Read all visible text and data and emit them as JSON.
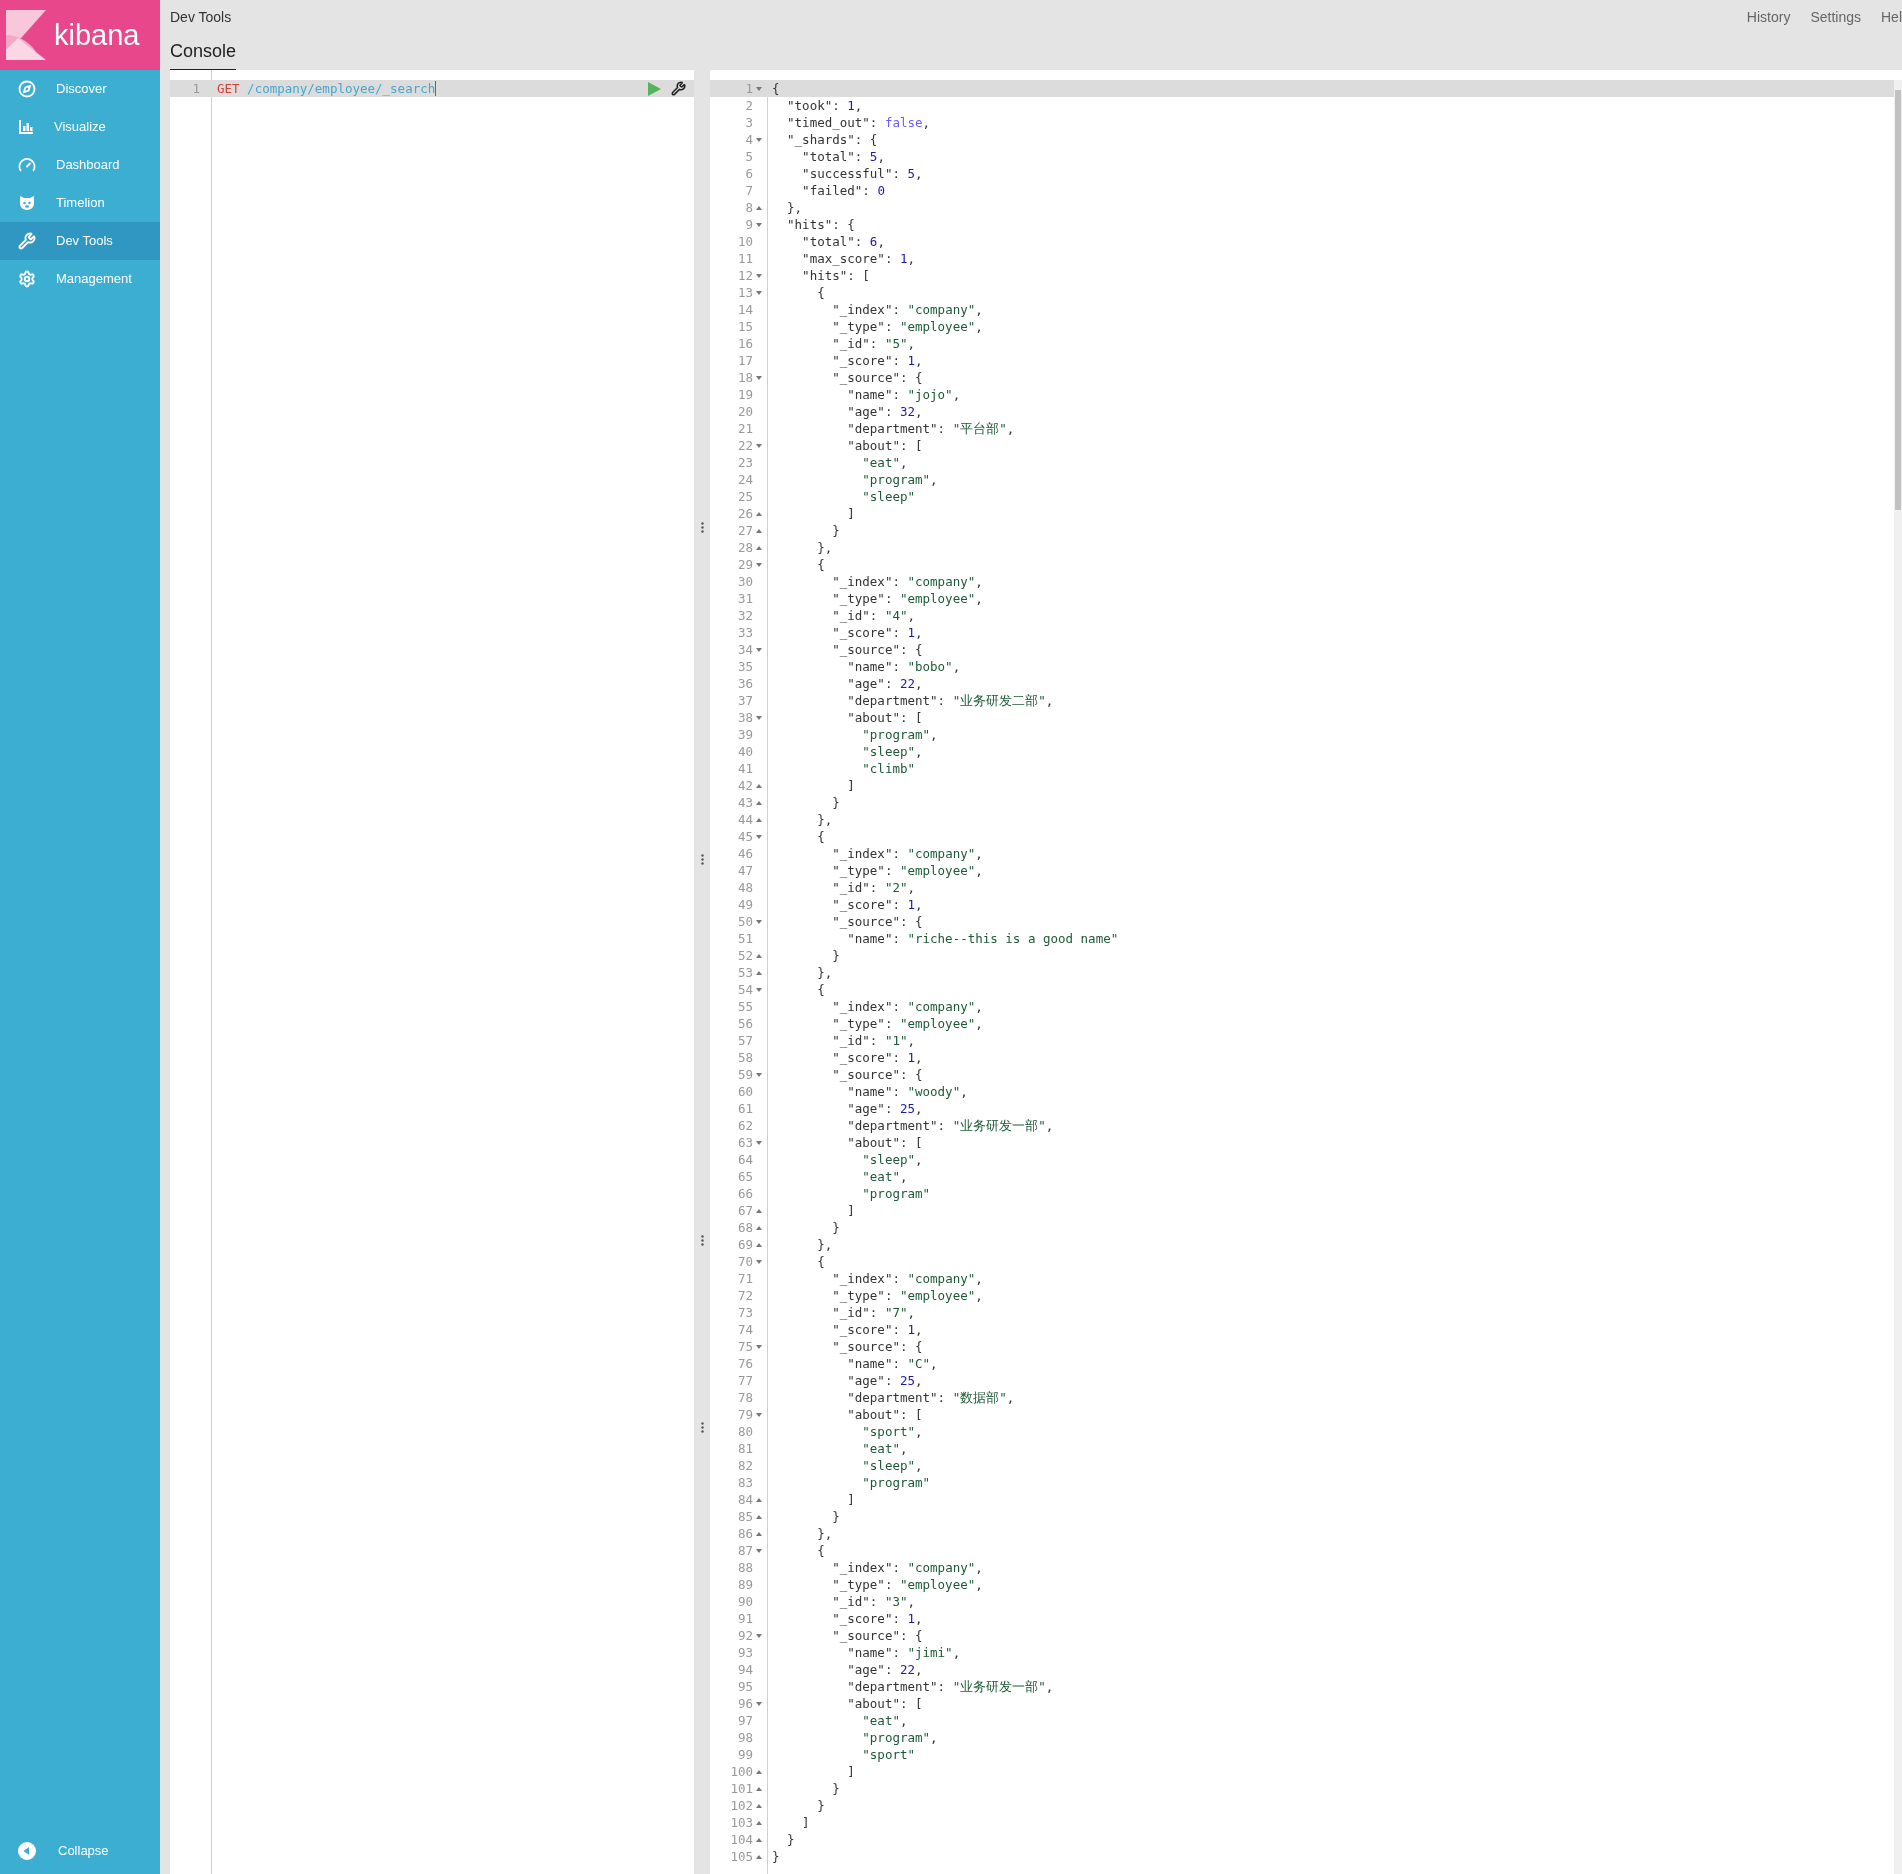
{
  "app": {
    "logo_text": "kibana"
  },
  "sidebar": {
    "items": [
      {
        "label": "Discover",
        "selected": false
      },
      {
        "label": "Visualize",
        "selected": false
      },
      {
        "label": "Dashboard",
        "selected": false
      },
      {
        "label": "Timelion",
        "selected": false
      },
      {
        "label": "Dev Tools",
        "selected": true
      },
      {
        "label": "Management",
        "selected": false
      }
    ],
    "collapse_label": "Collapse"
  },
  "header": {
    "breadcrumb": "Dev Tools",
    "tabs": [
      {
        "label": "Console",
        "selected": true
      }
    ],
    "links": [
      "History",
      "Settings",
      "Hel"
    ]
  },
  "request_editor": {
    "lines": [
      {
        "number": "1",
        "method": "GET",
        "path": "/company/employee/_search",
        "current": true
      }
    ]
  },
  "response_viewer": {
    "lines": [
      {
        "number": "1",
        "code": "{",
        "block_start": true,
        "current": true
      },
      {
        "number": "2",
        "code": "  \"took\": 1,",
        "current": false
      },
      {
        "number": "3",
        "code": "  \"timed_out\": false,",
        "current": false
      },
      {
        "number": "4",
        "code": "  \"_shards\": {",
        "block_start": true,
        "current": false
      },
      {
        "number": "5",
        "code": "    \"total\": 5,",
        "current": false
      },
      {
        "number": "6",
        "code": "    \"successful\": 5,",
        "current": false
      },
      {
        "number": "7",
        "code": "    \"failed\": 0",
        "current": false
      },
      {
        "number": "8",
        "code": "  },",
        "block_start": false,
        "current": false
      },
      {
        "number": "9",
        "code": "  \"hits\": {",
        "block_start": true,
        "current": false
      },
      {
        "number": "10",
        "code": "    \"total\": 6,",
        "current": false
      },
      {
        "number": "11",
        "code": "    \"max_score\": 1,",
        "current": false
      },
      {
        "number": "12",
        "code": "    \"hits\": [",
        "block_start": true,
        "current": false
      },
      {
        "number": "13",
        "code": "      {",
        "block_start": true,
        "current": false
      },
      {
        "number": "14",
        "code": "        \"_index\": \"company\",",
        "current": false
      },
      {
        "number": "15",
        "code": "        \"_type\": \"employee\",",
        "current": false
      },
      {
        "number": "16",
        "code": "        \"_id\": \"5\",",
        "current": false
      },
      {
        "number": "17",
        "code": "        \"_score\": 1,",
        "current": false
      },
      {
        "number": "18",
        "code": "        \"_source\": {",
        "block_start": true,
        "current": false
      },
      {
        "number": "19",
        "code": "          \"name\": \"jojo\",",
        "current": false
      },
      {
        "number": "20",
        "code": "          \"age\": 32,",
        "current": false
      },
      {
        "number": "21",
        "code": "          \"department\": \"平台部\",",
        "current": false
      },
      {
        "number": "22",
        "code": "          \"about\": [",
        "block_start": true,
        "current": false
      },
      {
        "number": "23",
        "code": "            \"eat\",",
        "current": false
      },
      {
        "number": "24",
        "code": "            \"program\",",
        "current": false
      },
      {
        "number": "25",
        "code": "            \"sleep\"",
        "current": false
      },
      {
        "number": "26",
        "code": "          ]",
        "block_start": false,
        "current": false
      },
      {
        "number": "27",
        "code": "        }",
        "block_start": false,
        "current": false
      },
      {
        "number": "28",
        "code": "      },",
        "block_start": false,
        "current": false
      },
      {
        "number": "29",
        "code": "      {",
        "block_start": true,
        "current": false
      },
      {
        "number": "30",
        "code": "        \"_index\": \"company\",",
        "current": false
      },
      {
        "number": "31",
        "code": "        \"_type\": \"employee\",",
        "current": false
      },
      {
        "number": "32",
        "code": "        \"_id\": \"4\",",
        "current": false
      },
      {
        "number": "33",
        "code": "        \"_score\": 1,",
        "current": false
      },
      {
        "number": "34",
        "code": "        \"_source\": {",
        "block_start": true,
        "current": false
      },
      {
        "number": "35",
        "code": "          \"name\": \"bobo\",",
        "current": false
      },
      {
        "number": "36",
        "code": "          \"age\": 22,",
        "current": false
      },
      {
        "number": "37",
        "code": "          \"department\": \"业务研发二部\",",
        "current": false
      },
      {
        "number": "38",
        "code": "          \"about\": [",
        "block_start": true,
        "current": false
      },
      {
        "number": "39",
        "code": "            \"program\",",
        "current": false
      },
      {
        "number": "40",
        "code": "            \"sleep\",",
        "current": false
      },
      {
        "number": "41",
        "code": "            \"climb\"",
        "current": false
      },
      {
        "number": "42",
        "code": "          ]",
        "block_start": false,
        "current": false
      },
      {
        "number": "43",
        "code": "        }",
        "block_start": false,
        "current": false
      },
      {
        "number": "44",
        "code": "      },",
        "block_start": false,
        "current": false
      },
      {
        "number": "45",
        "code": "      {",
        "block_start": true,
        "current": false
      },
      {
        "number": "46",
        "code": "        \"_index\": \"company\",",
        "current": false
      },
      {
        "number": "47",
        "code": "        \"_type\": \"employee\",",
        "current": false
      },
      {
        "number": "48",
        "code": "        \"_id\": \"2\",",
        "current": false
      },
      {
        "number": "49",
        "code": "        \"_score\": 1,",
        "current": false
      },
      {
        "number": "50",
        "code": "        \"_source\": {",
        "block_start": true,
        "current": false
      },
      {
        "number": "51",
        "code": "          \"name\": \"riche--this is a good name\"",
        "current": false
      },
      {
        "number": "52",
        "code": "        }",
        "block_start": false,
        "current": false
      },
      {
        "number": "53",
        "code": "      },",
        "block_start": false,
        "current": false
      },
      {
        "number": "54",
        "code": "      {",
        "block_start": true,
        "current": false
      },
      {
        "number": "55",
        "code": "        \"_index\": \"company\",",
        "current": false
      },
      {
        "number": "56",
        "code": "        \"_type\": \"employee\",",
        "current": false
      },
      {
        "number": "57",
        "code": "        \"_id\": \"1\",",
        "current": false
      },
      {
        "number": "58",
        "code": "        \"_score\": 1,",
        "current": false
      },
      {
        "number": "59",
        "code": "        \"_source\": {",
        "block_start": true,
        "current": false
      },
      {
        "number": "60",
        "code": "          \"name\": \"woody\",",
        "current": false
      },
      {
        "number": "61",
        "code": "          \"age\": 25,",
        "current": false
      },
      {
        "number": "62",
        "code": "          \"department\": \"业务研发一部\",",
        "current": false
      },
      {
        "number": "63",
        "code": "          \"about\": [",
        "block_start": true,
        "current": false
      },
      {
        "number": "64",
        "code": "            \"sleep\",",
        "current": false
      },
      {
        "number": "65",
        "code": "            \"eat\",",
        "current": false
      },
      {
        "number": "66",
        "code": "            \"program\"",
        "current": false
      },
      {
        "number": "67",
        "code": "          ]",
        "block_start": false,
        "current": false
      },
      {
        "number": "68",
        "code": "        }",
        "block_start": false,
        "current": false
      },
      {
        "number": "69",
        "code": "      },",
        "block_start": false,
        "current": false
      },
      {
        "number": "70",
        "code": "      {",
        "block_start": true,
        "current": false
      },
      {
        "number": "71",
        "code": "        \"_index\": \"company\",",
        "current": false
      },
      {
        "number": "72",
        "code": "        \"_type\": \"employee\",",
        "current": false
      },
      {
        "number": "73",
        "code": "        \"_id\": \"7\",",
        "current": false
      },
      {
        "number": "74",
        "code": "        \"_score\": 1,",
        "current": false
      },
      {
        "number": "75",
        "code": "        \"_source\": {",
        "block_start": true,
        "current": false
      },
      {
        "number": "76",
        "code": "          \"name\": \"C\",",
        "current": false
      },
      {
        "number": "77",
        "code": "          \"age\": 25,",
        "current": false
      },
      {
        "number": "78",
        "code": "          \"department\": \"数据部\",",
        "current": false
      },
      {
        "number": "79",
        "code": "          \"about\": [",
        "block_start": true,
        "current": false
      },
      {
        "number": "80",
        "code": "            \"sport\",",
        "current": false
      },
      {
        "number": "81",
        "code": "            \"eat\",",
        "current": false
      },
      {
        "number": "82",
        "code": "            \"sleep\",",
        "current": false
      },
      {
        "number": "83",
        "code": "            \"program\"",
        "current": false
      },
      {
        "number": "84",
        "code": "          ]",
        "block_start": false,
        "current": false
      },
      {
        "number": "85",
        "code": "        }",
        "block_start": false,
        "current": false
      },
      {
        "number": "86",
        "code": "      },",
        "block_start": false,
        "current": false
      },
      {
        "number": "87",
        "code": "      {",
        "block_start": true,
        "current": false
      },
      {
        "number": "88",
        "code": "        \"_index\": \"company\",",
        "current": false
      },
      {
        "number": "89",
        "code": "        \"_type\": \"employee\",",
        "current": false
      },
      {
        "number": "90",
        "code": "        \"_id\": \"3\",",
        "current": false
      },
      {
        "number": "91",
        "code": "        \"_score\": 1,",
        "current": false
      },
      {
        "number": "92",
        "code": "        \"_source\": {",
        "block_start": true,
        "current": false
      },
      {
        "number": "93",
        "code": "          \"name\": \"jimi\",",
        "current": false
      },
      {
        "number": "94",
        "code": "          \"age\": 22,",
        "current": false
      },
      {
        "number": "95",
        "code": "          \"department\": \"业务研发一部\",",
        "current": false
      },
      {
        "number": "96",
        "code": "          \"about\": [",
        "block_start": true,
        "current": false
      },
      {
        "number": "97",
        "code": "            \"eat\",",
        "current": false
      },
      {
        "number": "98",
        "code": "            \"program\",",
        "current": false
      },
      {
        "number": "99",
        "code": "            \"sport\"",
        "current": false
      },
      {
        "number": "100",
        "code": "          ]",
        "block_start": false,
        "current": false
      },
      {
        "number": "101",
        "code": "        }",
        "block_start": false,
        "current": false
      },
      {
        "number": "102",
        "code": "      }",
        "block_start": false,
        "current": false
      },
      {
        "number": "103",
        "code": "    ]",
        "block_start": false,
        "current": false
      },
      {
        "number": "104",
        "code": "  }",
        "block_start": false,
        "current": false
      },
      {
        "number": "105",
        "code": "}",
        "block_start": false,
        "current": false
      }
    ]
  }
}
